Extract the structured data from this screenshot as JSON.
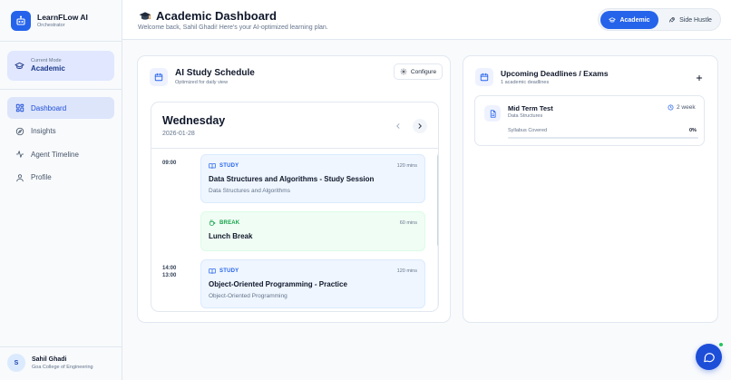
{
  "brand": {
    "name": "LearnFLow AI",
    "subtitle": "Orchestrator",
    "icon": "robot-icon",
    "color": "#2563eb"
  },
  "mode_card": {
    "label": "Current Mode",
    "value": "Academic",
    "icon": "graduation-cap-icon"
  },
  "nav": {
    "items": [
      {
        "label": "Dashboard",
        "icon": "dashboard-grid-icon",
        "active": true
      },
      {
        "label": "Insights",
        "icon": "compass-icon",
        "active": false
      },
      {
        "label": "Agent Timeline",
        "icon": "activity-icon",
        "active": false
      },
      {
        "label": "Profile",
        "icon": "user-icon",
        "active": false
      }
    ]
  },
  "user": {
    "initial": "S",
    "name": "Sahil Ghadi",
    "org": "Goa College of Engineering"
  },
  "header": {
    "title": "Academic Dashboard",
    "welcome": "Welcome back, Sahil Ghadi! Here's your AI-optimized learning plan.",
    "modes": [
      {
        "label": "Academic",
        "icon": "graduation-cap-icon",
        "active": true
      },
      {
        "label": "Side Hustle",
        "icon": "rocket-icon",
        "active": false
      }
    ]
  },
  "schedule": {
    "title": "AI Study Schedule",
    "subtitle": "Optimized for daily view",
    "configure_label": "Configure",
    "day": "Wednesday",
    "date": "2026-01-28",
    "events": [
      {
        "time": "09:00",
        "type": "STUDY",
        "duration": "120 mins",
        "title": "Data Structures and Algorithms - Study Session",
        "subject": "Data Structures and Algorithms"
      },
      {
        "time": "13:00",
        "type": "BREAK",
        "duration": "60 mins",
        "title": "Lunch Break",
        "subject": ""
      },
      {
        "time": "14:00",
        "type": "STUDY",
        "duration": "120 mins",
        "title": "Object-Oriented Programming - Practice",
        "subject": "Object-Oriented Programming"
      }
    ]
  },
  "deadlines": {
    "title": "Upcoming Deadlines / Exams",
    "subtitle": "1 academic deadlines",
    "add_label": "+",
    "items": [
      {
        "title": "Mid Term Test",
        "subject": "Data Structures",
        "due": "2 week",
        "progress_label": "Syllabus Covered",
        "progress_value": "0%",
        "progress": 0
      }
    ]
  },
  "colors": {
    "accent": "#2563eb",
    "study": "#2563eb",
    "break": "#16a34a",
    "online": "#22c55e"
  }
}
